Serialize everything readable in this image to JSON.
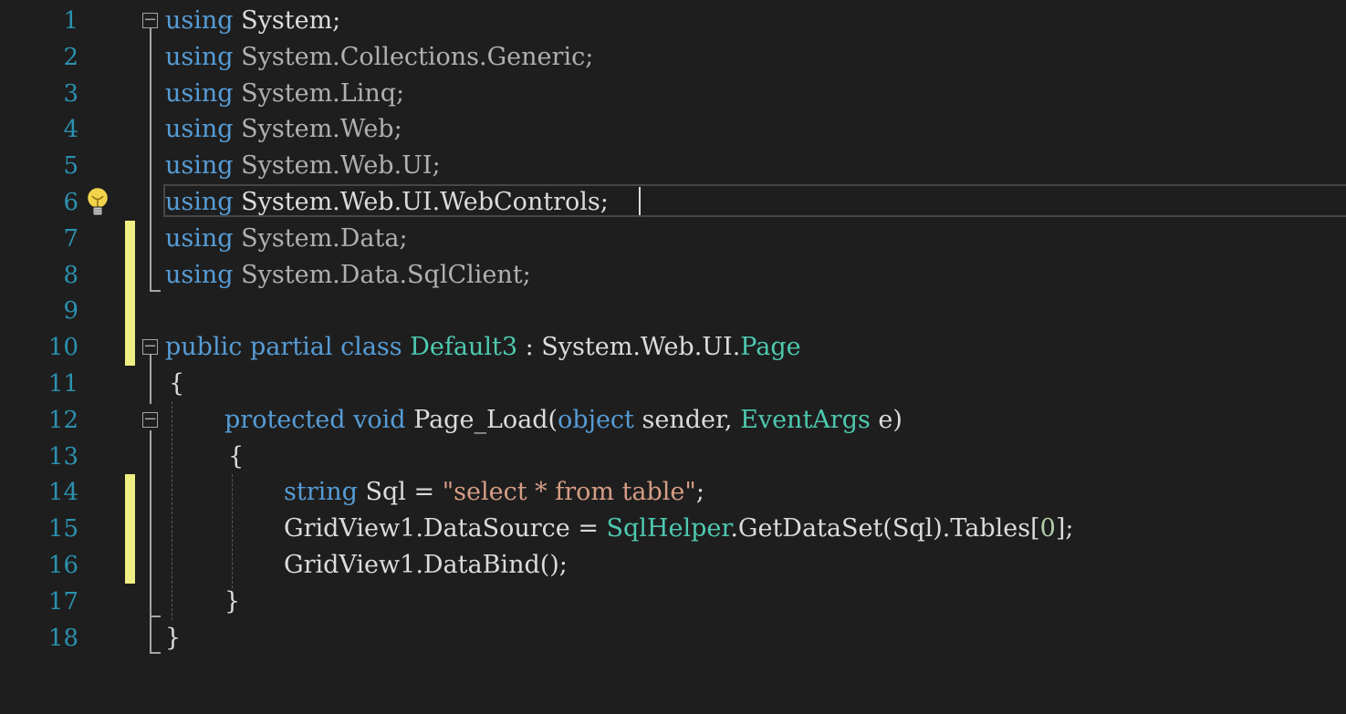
{
  "editor": {
    "language": "C#",
    "current_line": 6,
    "colors": {
      "background": "#1e1e1e",
      "line_number": "#2b91af",
      "keyword": "#569cd6",
      "type": "#4ec9b0",
      "string": "#d69d85",
      "number": "#b5cea8",
      "text": "#dcdcdc",
      "change_marker": "#eff084"
    },
    "lightbulb_icon": "lightbulb-icon",
    "lines": [
      {
        "n": "1",
        "changed": false,
        "tokens": [
          [
            "kw",
            "using"
          ],
          [
            "tx",
            " System;"
          ]
        ]
      },
      {
        "n": "2",
        "changed": false,
        "tokens": [
          [
            "kw",
            "using"
          ],
          [
            "dim",
            " System.Collections.Generic;"
          ]
        ]
      },
      {
        "n": "3",
        "changed": false,
        "tokens": [
          [
            "kw",
            "using"
          ],
          [
            "dim",
            " System.Linq;"
          ]
        ]
      },
      {
        "n": "4",
        "changed": false,
        "tokens": [
          [
            "kw",
            "using"
          ],
          [
            "dim",
            " System.Web;"
          ]
        ]
      },
      {
        "n": "5",
        "changed": false,
        "tokens": [
          [
            "kw",
            "using"
          ],
          [
            "dim",
            " System.Web.UI;"
          ]
        ]
      },
      {
        "n": "6",
        "changed": false,
        "tokens": [
          [
            "kw",
            "using"
          ],
          [
            "tx",
            " System.Web.UI.WebControls;"
          ]
        ]
      },
      {
        "n": "7",
        "changed": true,
        "tokens": [
          [
            "kw",
            "using"
          ],
          [
            "dim",
            " System.Data;"
          ]
        ]
      },
      {
        "n": "8",
        "changed": true,
        "tokens": [
          [
            "kw",
            "using"
          ],
          [
            "dim",
            " System.Data.SqlClient;"
          ]
        ]
      },
      {
        "n": "9",
        "changed": true,
        "tokens": []
      },
      {
        "n": "10",
        "changed": true,
        "tokens": [
          [
            "kw",
            "public"
          ],
          [
            "tx",
            " "
          ],
          [
            "kw",
            "partial"
          ],
          [
            "tx",
            " "
          ],
          [
            "kw",
            "class"
          ],
          [
            "tx",
            " "
          ],
          [
            "ty",
            "Default3"
          ],
          [
            "tx",
            " : System.Web.UI."
          ],
          [
            "ty",
            "Page"
          ]
        ]
      },
      {
        "n": "11",
        "changed": false,
        "tokens": [
          [
            "tx",
            "{"
          ]
        ]
      },
      {
        "n": "12",
        "changed": false,
        "tokens": [
          [
            "kw",
            "protected"
          ],
          [
            "tx",
            " "
          ],
          [
            "kw",
            "void"
          ],
          [
            "tx",
            " Page_Load("
          ],
          [
            "kw",
            "object"
          ],
          [
            "tx",
            " sender, "
          ],
          [
            "ty",
            "EventArgs"
          ],
          [
            "tx",
            " e)"
          ]
        ]
      },
      {
        "n": "13",
        "changed": false,
        "tokens": [
          [
            "tx",
            "{"
          ]
        ]
      },
      {
        "n": "14",
        "changed": true,
        "tokens": [
          [
            "kw",
            "string"
          ],
          [
            "tx",
            " Sql = "
          ],
          [
            "st",
            "\"select * from table\""
          ],
          [
            "tx",
            ";"
          ]
        ]
      },
      {
        "n": "15",
        "changed": true,
        "tokens": [
          [
            "tx",
            "GridView1.DataSource = "
          ],
          [
            "ty",
            "SqlHelper"
          ],
          [
            "tx",
            ".GetDataSet(Sql).Tables["
          ],
          [
            "nm",
            "0"
          ],
          [
            "tx",
            "];"
          ]
        ]
      },
      {
        "n": "16",
        "changed": true,
        "tokens": [
          [
            "tx",
            "GridView1.DataBind();"
          ]
        ]
      },
      {
        "n": "17",
        "changed": false,
        "tokens": [
          [
            "tx",
            "}"
          ]
        ]
      },
      {
        "n": "18",
        "changed": false,
        "tokens": [
          [
            "tx",
            "}"
          ]
        ]
      }
    ]
  }
}
